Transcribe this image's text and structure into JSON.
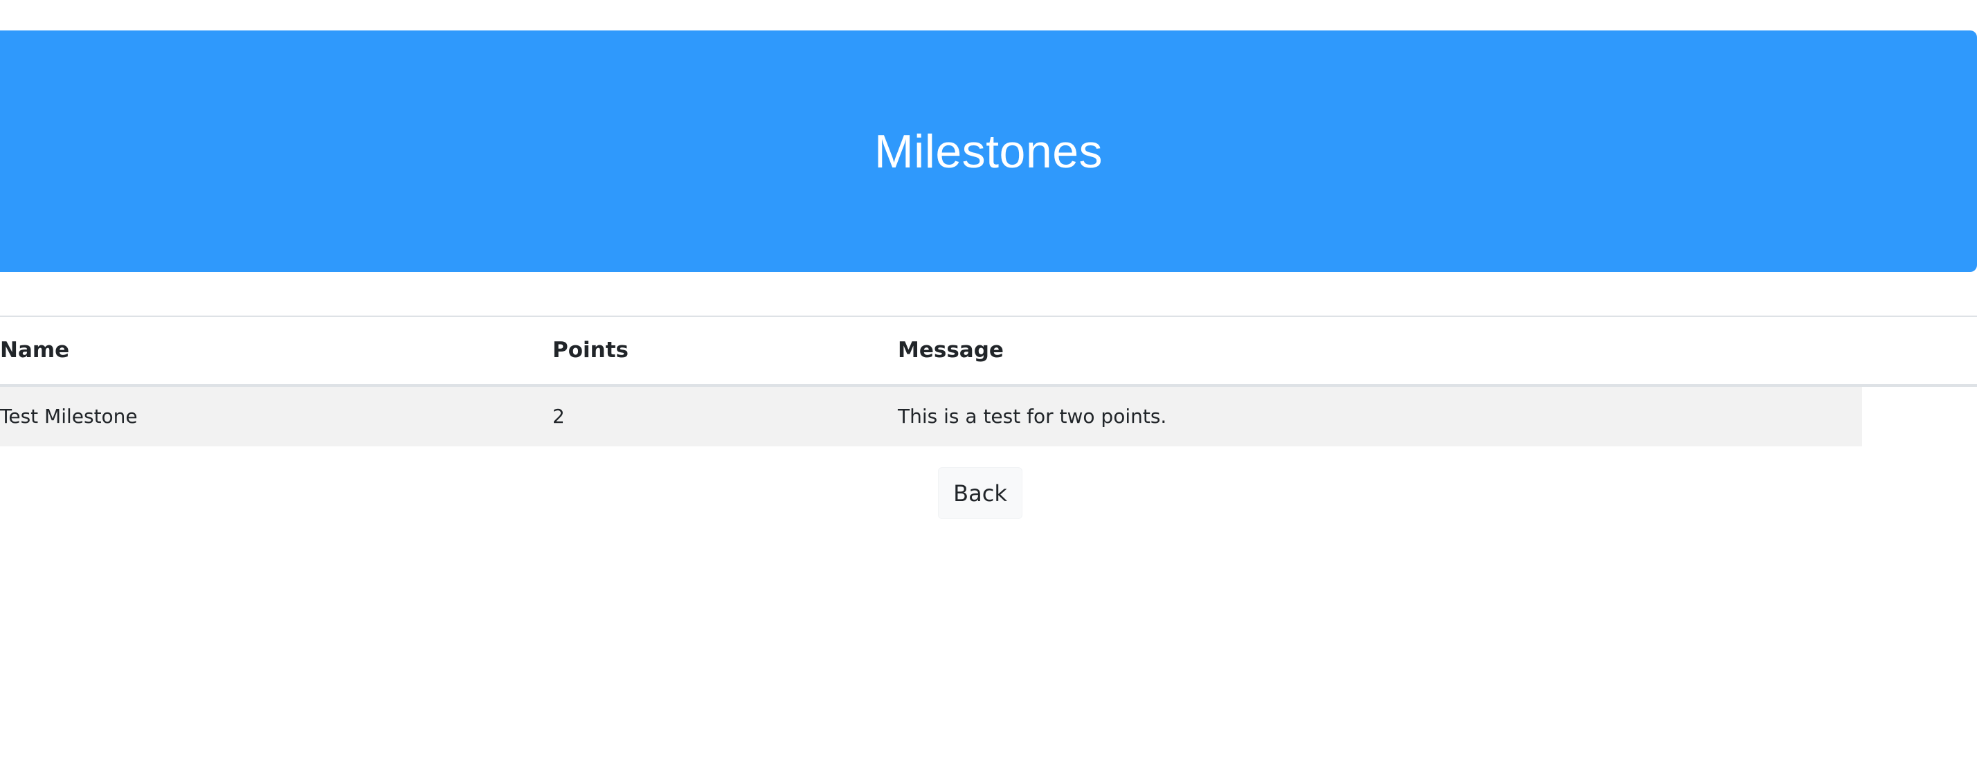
{
  "header": {
    "title": "Milestones",
    "background_color": "#2f99fc"
  },
  "table": {
    "columns": [
      "Name",
      "Points",
      "Message"
    ],
    "rows": [
      {
        "name": "Test Milestone",
        "points": "2",
        "message": "This is a test for two points."
      }
    ]
  },
  "actions": {
    "back_label": "Back"
  }
}
